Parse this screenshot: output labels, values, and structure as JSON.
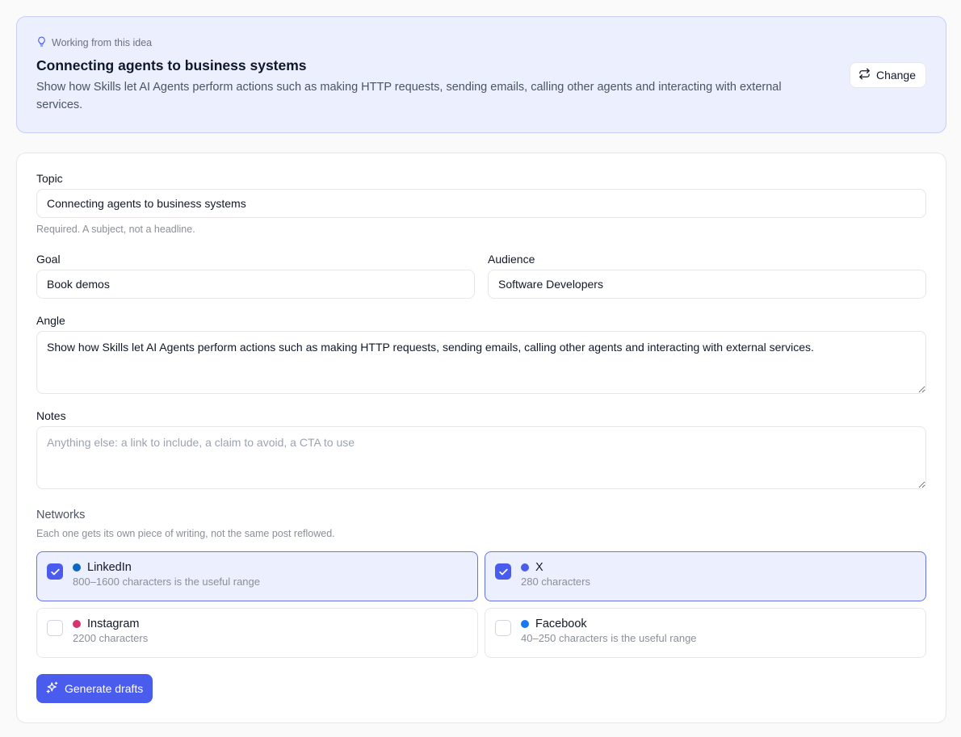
{
  "idea": {
    "kicker": "Working from this idea",
    "title": "Connecting agents to business systems",
    "description": "Show how Skills let AI Agents perform actions such as making HTTP requests, sending emails, calling other agents and interacting with external services.",
    "change_label": "Change"
  },
  "form": {
    "topic": {
      "label": "Topic",
      "value": "Connecting agents to business systems",
      "hint": "Required. A subject, not a headline."
    },
    "goal": {
      "label": "Goal",
      "value": "Book demos"
    },
    "audience": {
      "label": "Audience",
      "value": "Software Developers"
    },
    "angle": {
      "label": "Angle",
      "value": "Show how Skills let AI Agents perform actions such as making HTTP requests, sending emails, calling other agents and interacting with external services."
    },
    "notes": {
      "label": "Notes",
      "value": "",
      "placeholder": "Anything else: a link to include, a claim to avoid, a CTA to use"
    }
  },
  "networks": {
    "title": "Networks",
    "hint": "Each one gets its own piece of writing, not the same post reflowed.",
    "items": [
      {
        "name": "LinkedIn",
        "description": "800–1600 characters is the useful range",
        "selected": true,
        "color": "#0a66c2"
      },
      {
        "name": "X",
        "description": "280 characters",
        "selected": true,
        "color": "#4a5ced"
      },
      {
        "name": "Instagram",
        "description": "2200 characters",
        "selected": false,
        "color": "#d6336c"
      },
      {
        "name": "Facebook",
        "description": "40–250 characters is the useful range",
        "selected": false,
        "color": "#1877f2"
      }
    ]
  },
  "actions": {
    "generate_label": "Generate drafts"
  },
  "colors": {
    "accent": "#4a5ced",
    "idea_background": "#eceffd"
  }
}
